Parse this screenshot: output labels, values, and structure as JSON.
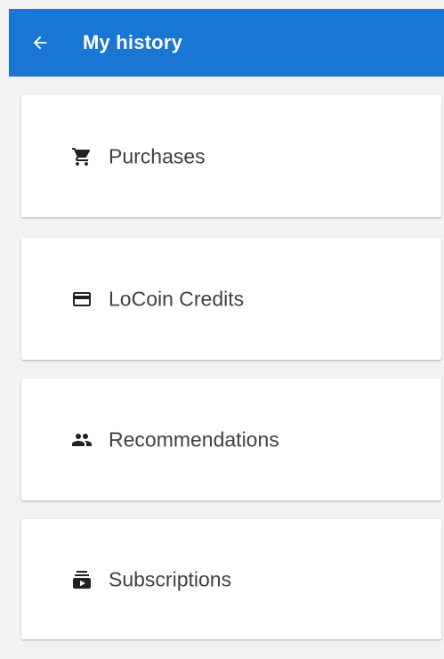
{
  "header": {
    "title": "My history",
    "background_color": "#1976d2",
    "back_icon": "arrow-back-icon"
  },
  "menu": {
    "items": [
      {
        "label": "Purchases",
        "icon": "shopping-cart-icon"
      },
      {
        "label": "LoCoin Credits",
        "icon": "credit-card-icon"
      },
      {
        "label": "Recommendations",
        "icon": "people-icon"
      },
      {
        "label": "Subscriptions",
        "icon": "subscriptions-icon"
      }
    ]
  },
  "colors": {
    "page_background": "#f2f2f2",
    "card_background": "#ffffff",
    "text": "#404040",
    "icon": "#222222"
  }
}
